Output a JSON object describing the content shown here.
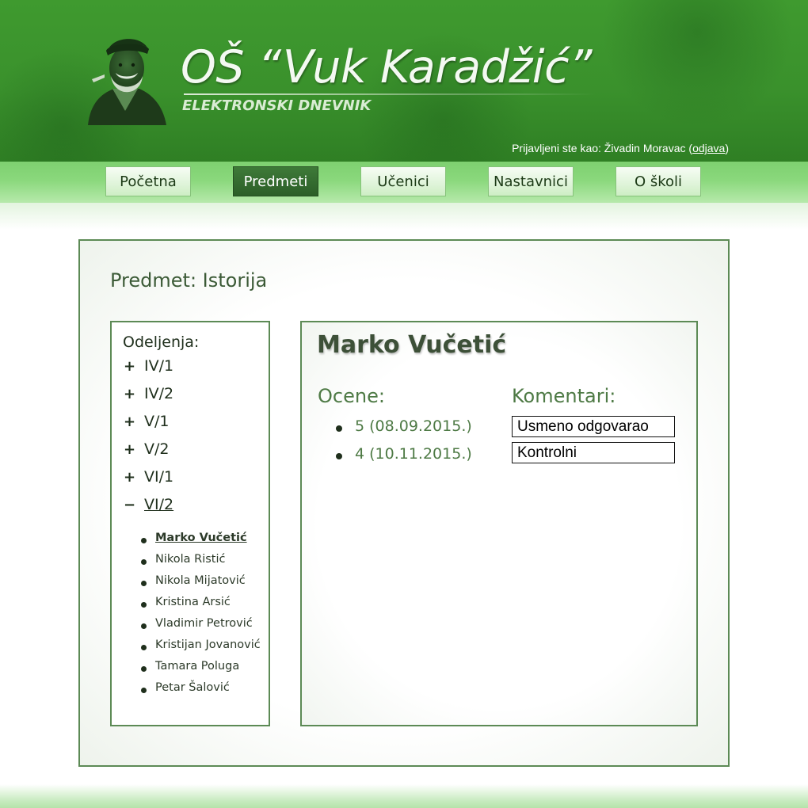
{
  "header": {
    "title": "OŠ “Vuk Karadžić”",
    "subtitle": "ELEKTRONSKI DNEVNIK",
    "login_prefix": "Prijavljeni ste kao: Živadin Moravac (",
    "logout_label": "odjava",
    "login_suffix": ")"
  },
  "nav": {
    "items": [
      {
        "label": "Početna",
        "active": false
      },
      {
        "label": "Predmeti",
        "active": true
      },
      {
        "label": "Učenici",
        "active": false
      },
      {
        "label": "Nastavnici",
        "active": false
      },
      {
        "label": "O školi",
        "active": false
      }
    ]
  },
  "main": {
    "subject": "Predmet: Istorija",
    "tree": {
      "heading": "Odeljenja:",
      "classes": [
        {
          "label": "IV/1",
          "sign": "+"
        },
        {
          "label": "IV/2",
          "sign": "+"
        },
        {
          "label": "V/1",
          "sign": "+"
        },
        {
          "label": "V/2",
          "sign": "+"
        },
        {
          "label": "VI/1",
          "sign": "+"
        },
        {
          "label": "VI/2",
          "sign": "−"
        }
      ],
      "students": [
        "Marko  Vučetić",
        "Nikola Ristić",
        "Nikola Mijatović",
        "Kristina Arsić",
        "Vladimir Petrović",
        "Kristijan Jovanović",
        "Tamara Poluga",
        "Petar Šalović"
      ]
    },
    "detail": {
      "student_name": "Marko Vučetić",
      "grades_heading": "Ocene:",
      "comments_heading": "Komentari:",
      "grades": [
        "5 (08.09.2015.)",
        "4 (10.11.2015.)"
      ],
      "comments": [
        "Usmeno odgovarao",
        "Kontrolni"
      ]
    }
  },
  "colors": {
    "header_green": "#3a912c",
    "nav_green": "#8ad87c",
    "active_button": "#2c5e28",
    "border_green": "#5c8a55",
    "text_green": "#4e7a45"
  }
}
